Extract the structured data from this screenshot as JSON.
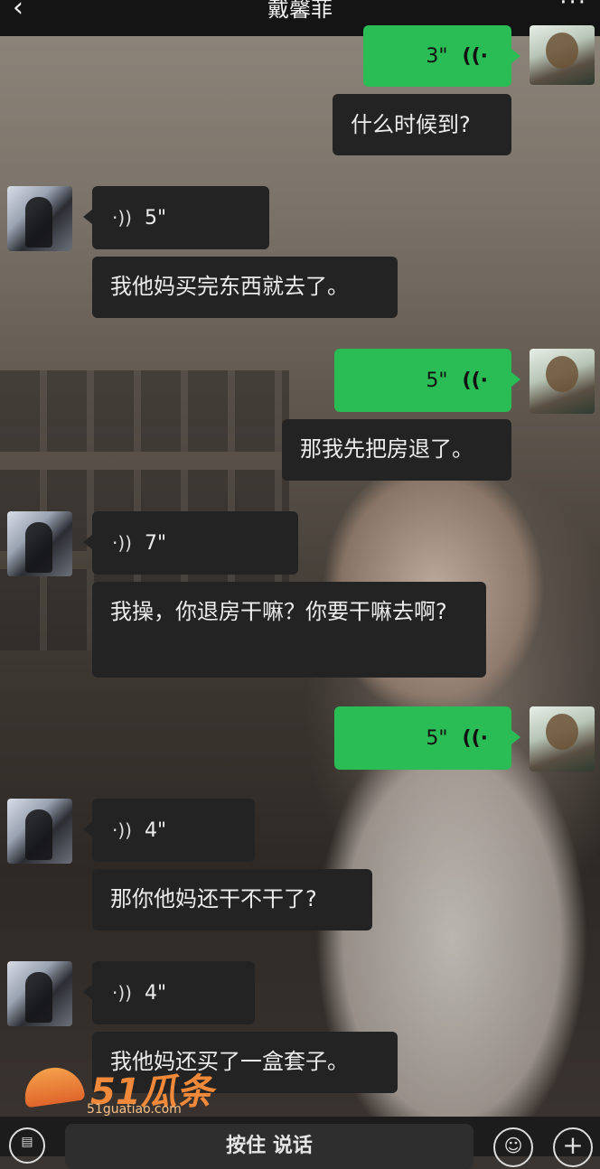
{
  "header": {
    "title": "戴馨菲",
    "back_icon": "chevron-left-icon",
    "more_icon": "more-dots-icon"
  },
  "messages": [
    {
      "from": "me",
      "type": "voice",
      "duration": "3\""
    },
    {
      "from": "me",
      "type": "text",
      "text": "什么时候到?"
    },
    {
      "from": "her",
      "type": "voice",
      "duration": "5\""
    },
    {
      "from": "her",
      "type": "text",
      "text": "我他妈买完东西就去了。"
    },
    {
      "from": "me",
      "type": "voice",
      "duration": "5\""
    },
    {
      "from": "me",
      "type": "text",
      "text": "那我先把房退了。"
    },
    {
      "from": "her",
      "type": "voice",
      "duration": "7\""
    },
    {
      "from": "her",
      "type": "text",
      "text": "我操，你退房干嘛？你要干嘛去啊?"
    },
    {
      "from": "me",
      "type": "voice",
      "duration": "5\""
    },
    {
      "from": "her",
      "type": "voice",
      "duration": "4\""
    },
    {
      "from": "her",
      "type": "text",
      "text": "那你他妈还干不干了?"
    },
    {
      "from": "her",
      "type": "voice",
      "duration": "4\""
    },
    {
      "from": "her",
      "type": "text",
      "text": "我他妈还买了一盒套子。"
    }
  ],
  "watermark": {
    "brand": "51瓜条",
    "url": "51guatiao.com"
  },
  "input_bar": {
    "hold_to_talk": "按住 说话",
    "keyboard_icon": "keyboard-icon",
    "emoji_icon": "emoji-icon",
    "plus_icon": "plus-icon"
  },
  "colors": {
    "outgoing_bubble": "#2bbd55",
    "incoming_bubble": "#232323",
    "header": "#141414"
  }
}
